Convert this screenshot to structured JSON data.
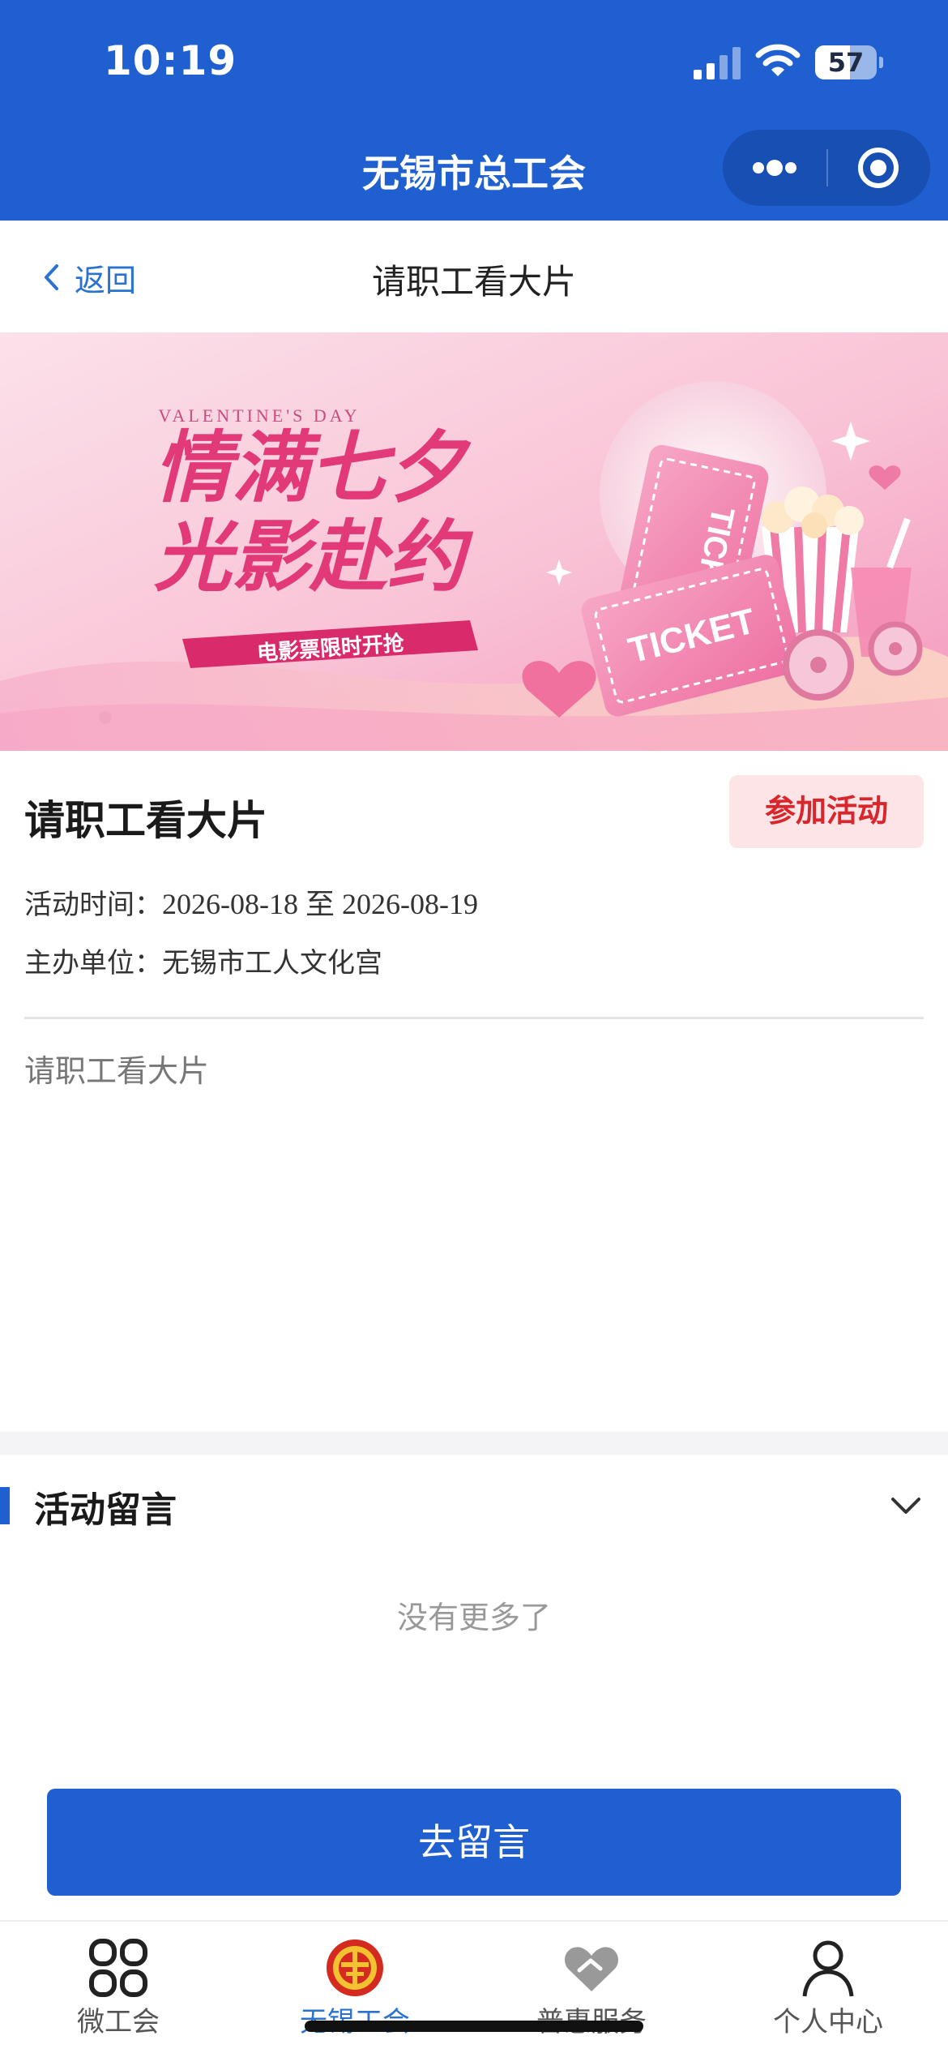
{
  "status_bar": {
    "time": "10:19",
    "battery": "57",
    "battery_level": 0.57
  },
  "app": {
    "title": "无锡市总工会"
  },
  "nav": {
    "back_label": "返回",
    "page_title": "请职工看大片"
  },
  "banner": {
    "header_small": "VALENTINE'S DAY",
    "headline_line1": "情满七夕",
    "headline_line2": "光影赴约",
    "ribbon": "电影票限时开抢",
    "ticket_small": "TICKE",
    "ticket_large": "TICKET"
  },
  "activity": {
    "title": "请职工看大片",
    "join_label": "参加活动",
    "time_label": "活动时间：",
    "time_value": "2026-08-18 至 2026-08-19",
    "org_label": "主办单位：",
    "org_value": "无锡市工人文化宫",
    "description": "请职工看大片"
  },
  "comments": {
    "section_title": "活动留言",
    "empty_text": "没有更多了",
    "action_label": "去留言"
  },
  "tabbar": {
    "items": [
      {
        "label": "微工会",
        "icon": "grid-icon"
      },
      {
        "label": "无锡工会",
        "icon": "union-logo-icon",
        "active": true
      },
      {
        "label": "普惠服务",
        "icon": "heart-hand-icon"
      },
      {
        "label": "个人中心",
        "icon": "person-icon"
      }
    ]
  },
  "colors": {
    "brand": "#1f5fcf",
    "accent_red": "#d9262c",
    "link": "#2a72d0"
  }
}
